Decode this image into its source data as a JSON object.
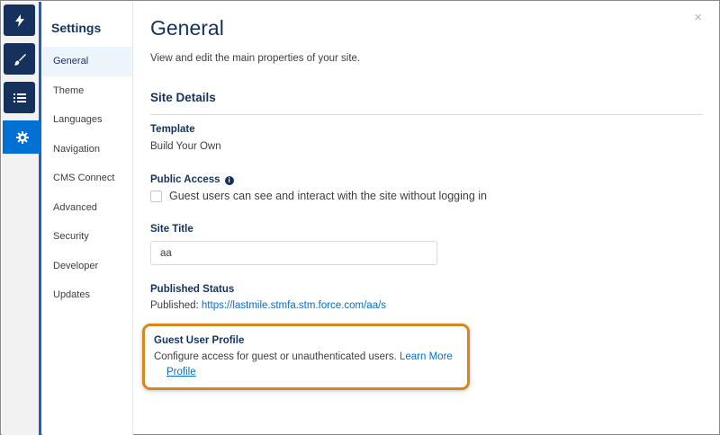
{
  "rail": {
    "buttons": [
      {
        "icon": "lightning-icon",
        "active": false
      },
      {
        "icon": "brush-icon",
        "active": false
      },
      {
        "icon": "list-icon",
        "active": false
      },
      {
        "icon": "gear-icon",
        "active": true
      }
    ]
  },
  "nav": {
    "title": "Settings",
    "items": [
      {
        "label": "General",
        "active": true
      },
      {
        "label": "Theme",
        "active": false
      },
      {
        "label": "Languages",
        "active": false
      },
      {
        "label": "Navigation",
        "active": false
      },
      {
        "label": "CMS Connect",
        "active": false
      },
      {
        "label": "Advanced",
        "active": false
      },
      {
        "label": "Security",
        "active": false
      },
      {
        "label": "Developer",
        "active": false
      },
      {
        "label": "Updates",
        "active": false
      }
    ]
  },
  "main": {
    "close_icon": "×",
    "title": "General",
    "description": "View and edit the main properties of your site.",
    "section_title": "Site Details",
    "template": {
      "label": "Template",
      "value": "Build Your Own"
    },
    "public_access": {
      "label": "Public Access",
      "info_icon": "i",
      "checkbox_label": "Guest users can see and interact with the site without logging in",
      "checked": false
    },
    "site_title": {
      "label": "Site Title",
      "value": "aa"
    },
    "published_status": {
      "label": "Published Status",
      "prefix": "Published: ",
      "url": "https://lastmile.stmfa.stm.force.com/aa/s"
    },
    "guest_user_profile": {
      "label": "Guest User Profile",
      "description": "Configure access for guest or unauthenticated users.",
      "learn_more": "Learn More",
      "profile_link": "Profile"
    }
  },
  "colors": {
    "rail_dark": "#16325c",
    "rail_active": "#0070d2",
    "link": "#0070d2",
    "highlight_border": "#d7871c"
  }
}
